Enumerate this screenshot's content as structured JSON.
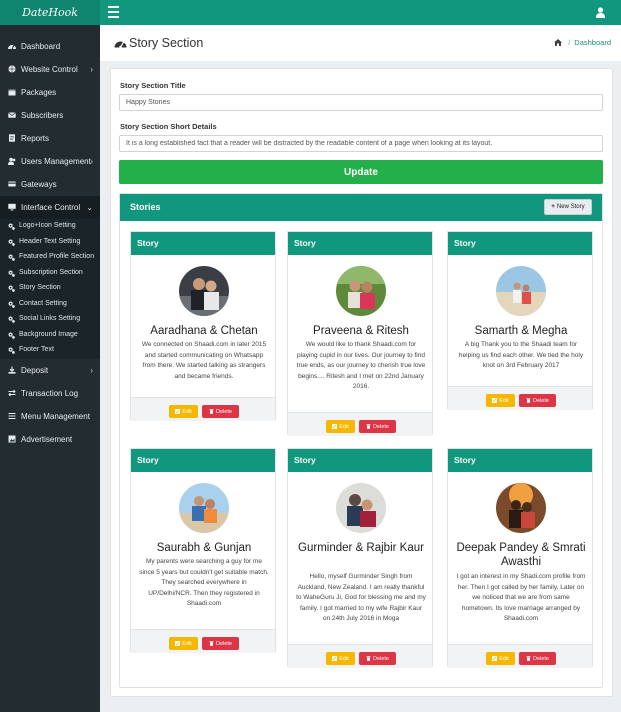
{
  "app": {
    "brand": "DateHook"
  },
  "sidebar": {
    "items": [
      {
        "label": "Dashboard",
        "icon": "dashboard-icon",
        "has_children": false
      },
      {
        "label": "Website Control",
        "icon": "globe-icon",
        "has_children": true
      },
      {
        "label": "Packages",
        "icon": "package-icon",
        "has_children": false
      },
      {
        "label": "Subscribers",
        "icon": "envelope-icon",
        "has_children": false
      },
      {
        "label": "Reports",
        "icon": "report-icon",
        "has_children": false
      },
      {
        "label": "Users Management",
        "icon": "users-icon",
        "has_children": true
      },
      {
        "label": "Gateways",
        "icon": "credit-card-icon",
        "has_children": false
      },
      {
        "label": "Interface Control",
        "icon": "desktop-icon",
        "has_children": true,
        "expanded": true
      },
      {
        "label": "Deposit",
        "icon": "download-icon",
        "has_children": true
      },
      {
        "label": "Transaction Log",
        "icon": "exchange-icon",
        "has_children": false
      },
      {
        "label": "Menu Management",
        "icon": "menu-icon",
        "has_children": false
      },
      {
        "label": "Advertisement",
        "icon": "image-icon",
        "has_children": false
      }
    ],
    "sub_items": [
      {
        "label": "Logo+Icon Setting"
      },
      {
        "label": "Header Text Setting"
      },
      {
        "label": "Featured Profile Section"
      },
      {
        "label": "Subscription Section"
      },
      {
        "label": "Story Section"
      },
      {
        "label": "Contact Setting"
      },
      {
        "label": "Social Links Setting"
      },
      {
        "label": "Background Image"
      },
      {
        "label": "Footer Text"
      }
    ]
  },
  "page": {
    "title": "Story Section",
    "breadcrumb_sep": "/",
    "breadcrumb": "Dashboard"
  },
  "form": {
    "title_label": "Story Section Title",
    "title_value": "Happy Stories",
    "desc_label": "Story Section Short Details",
    "desc_value": "It is a long established fact that a reader will be distracted by the readable content of a page when looking at its layout.",
    "update_label": "Update"
  },
  "stories": {
    "panel_title": "Stories",
    "new_story_label": "New Story",
    "card_header": "Story",
    "edit_label": "Edit",
    "delete_label": "Delete",
    "cards": [
      {
        "name": "Aaradhana & Chetan",
        "desc": "We connected on Shaadi.com in later 2015 and started communicating on Whatsapp from there. We started talking as strangers and became friends."
      },
      {
        "name": "Praveena & Ritesh",
        "desc": "We would like to thank Shaadi.com for playing cupid in our lives. Our journey to find true ends, as our journey to cherish true love begins.... Ritesh and I met on 22nd January 2016."
      },
      {
        "name": "Samarth & Megha",
        "desc": "A big Thank you to the Shaadi team for helping us find each other. We tied the holy knot on 3rd February 2017"
      },
      {
        "name": "Saurabh & Gunjan",
        "desc": "My parents were searching a guy for me since 5 years but couldn't get suitable match. They searched everywhere in UP/Delhi/NCR. Then they registered in Shaadi.com"
      },
      {
        "name": "Gurminder & Rajbir Kaur",
        "desc": "Hello, myself Gurminder Singh from Auckland, New Zealand. I am really thankful to WaheGuru Ji, God for blessing me and my family. I got married to my wife Rajbir Kaur on 24th July 2016 in Moga"
      },
      {
        "name": "Deepak Pandey & Smrati Awasthi",
        "desc": "I got an interest in my Shadi.com profile from her. Then I got called by her family. Later on we noticed that we are from same hometown. Its love marriage arranged by Shaadi.com"
      }
    ]
  },
  "colors": {
    "brand": "#12977f",
    "sidebar_bg": "#222c31",
    "update_btn": "#23b04a",
    "edit_btn": "#f5b700",
    "delete_btn": "#dc3545"
  }
}
